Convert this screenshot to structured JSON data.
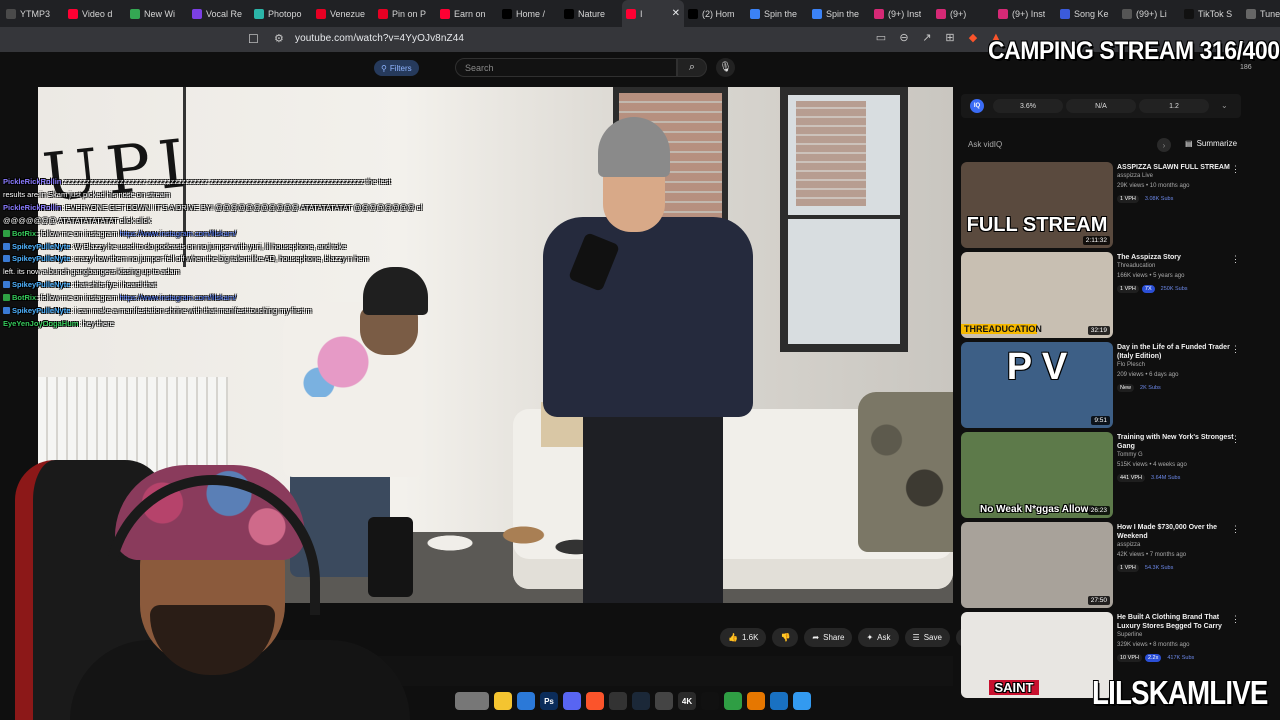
{
  "browser": {
    "tabs": [
      {
        "label": "YTMP3",
        "color": "#4a4a4a"
      },
      {
        "label": "Video d",
        "color": "#ff0033"
      },
      {
        "label": "New Wi",
        "color": "#34a853"
      },
      {
        "label": "Vocal Re",
        "color": "#7b3fe4"
      },
      {
        "label": "Photopo",
        "color": "#2bb5a8"
      },
      {
        "label": "Venezue",
        "color": "#e60023"
      },
      {
        "label": "Pin on P",
        "color": "#e60023"
      },
      {
        "label": "Earn on",
        "color": "#ff0033"
      },
      {
        "label": "Home /",
        "color": "#000000"
      },
      {
        "label": "Nature",
        "color": "#000000"
      },
      {
        "label": "I",
        "color": "#ff0033",
        "active": true,
        "close": "✕"
      },
      {
        "label": "(2) Hom",
        "color": "#000000"
      },
      {
        "label": "Spin the",
        "color": "#3b82f6"
      },
      {
        "label": "Spin the",
        "color": "#3b82f6"
      },
      {
        "label": "(9+) Inst",
        "color": "#d62976"
      },
      {
        "label": "(9+)",
        "color": "#d62976"
      },
      {
        "label": "(9+) Inst",
        "color": "#d62976"
      },
      {
        "label": "Song Ke",
        "color": "#3b5bdb"
      },
      {
        "label": "(99+) Li",
        "color": "#555555"
      },
      {
        "label": "TikTok S",
        "color": "#111111"
      },
      {
        "label": "Tunes",
        "color": "#666666"
      }
    ],
    "url": "youtube.com/watch?v=4YyOJv8nZ44",
    "bookmark_icon": "bookmark-icon",
    "addr_icons": [
      "screencast-icon",
      "zoom-icon",
      "share-icon",
      "install-icon",
      "brave-shields-icon",
      "rewards-icon"
    ]
  },
  "overlay": {
    "camping": "CAMPING STREAM 316/400",
    "channel": "LILSKAMLIVE",
    "counter": "186"
  },
  "youtube": {
    "filters_label": "Filters",
    "search_placeholder": "Search",
    "actions": {
      "like_count": "1.6K",
      "share": "Share",
      "ask": "Ask",
      "save": "Save"
    }
  },
  "chat": [
    {
      "user": "PickleRickRollin",
      "user_color": "#8a7bff",
      "text": " zzzzzzzzzzzzzzzzzzzzzz zzzzzzzzzzzzzzzz zzzzzzzzzzzzzzzzzzzzzzzzzzzzzzzzzzzzzzzzz the test",
      "badge": ""
    },
    {
      "user": "",
      "user_color": "#ffffff",
      "text": "results are in Skam just picked his nose on stream",
      "badge": ""
    },
    {
      "user": "PickleRickRollin",
      "user_color": "#8a7bff",
      "text": ": EVERYONE GET DOWN! IT'S A DRIVE BY! @@@@@@@@@@@ ATATATATATAT @@@@@@@@ click click",
      "badge": ""
    },
    {
      "user": "",
      "user_color": "#ffffff",
      "text": "@@@@@@@ ATATATATATATAT click click",
      "badge": ""
    },
    {
      "user": "BotRix",
      "user_color": "#35c95a",
      "text": ": follow me on instagram ",
      "link": "https://www.instagram.com/lilskam/",
      "badge": "#2ea043"
    },
    {
      "user": "SpikeyPulleNyte",
      "user_color": "#4fb3ff",
      "text": ": W Blazzy he used to do podcasts on no jumper with yuri, lil housephone, and toke",
      "badge": "#3a7bd5"
    },
    {
      "user": "SpikeyPulleNyte",
      "user_color": "#4fb3ff",
      "text": ": crazy how them no jumper fell off when the big talent like AD, housephone, blazzy n hem",
      "badge": "#3a7bd5"
    },
    {
      "user": "",
      "user_color": "#ffffff",
      "text": "left. its now a bunch gangbangers kissing up to adam",
      "badge": ""
    },
    {
      "user": "SpikeyPulleNyte",
      "user_color": "#4fb3ff",
      "text": ": that shits fye i heard that",
      "badge": "#3a7bd5"
    },
    {
      "user": "BotRix",
      "user_color": "#35c95a",
      "text": ": follow me on instagram ",
      "link": "https://www.instagram.com/lilskam/",
      "badge": "#2ea043"
    },
    {
      "user": "SpikeyPulleNyte",
      "user_color": "#4fb3ff",
      "text": ": i can make a manifestation shrine with that manifest touching my first m",
      "badge": "#3a7bd5"
    },
    {
      "user": "EyeYenJoyOogaHum",
      "user_color": "#35c95a",
      "text": ": hey there",
      "badge": ""
    }
  ],
  "sidebar": {
    "vidiq": {
      "logo": "IQ",
      "stats": [
        "3.6%",
        "N/A",
        "1.2"
      ]
    },
    "ask_placeholder": "Ask vidIQ",
    "summarize": "Summarize",
    "recommendations": [
      {
        "title": "ASSPIZZA SLAWN FULL STREAM",
        "channel": "asspizza Live",
        "meta": "29K views • 10 months ago",
        "badges": [
          "1 VPH",
          "",
          "3.08K Subs"
        ],
        "duration": "2:11:32",
        "thumb_text": "FULL STREAM",
        "thumb_bg": "#5a4a3e"
      },
      {
        "title": "The Asspizza Story",
        "channel": "Threaducation",
        "meta": "166K views • 5 years ago",
        "badges": [
          "1 VPH",
          "7X",
          "250K Subs"
        ],
        "duration": "32:19",
        "thumb_text": "THREADUCATION",
        "thumb_bg": "#c8bfb2"
      },
      {
        "title": "Day in the Life of a Funded Trader (Italy Edition)",
        "channel": "Flo Plesch",
        "meta": "209 views • 6 days ago",
        "badges": [
          "New",
          "",
          "2K Subs"
        ],
        "duration": "9:51",
        "thumb_text": "P  V",
        "thumb_bg": "#3d5f86"
      },
      {
        "title": "Training with New York's Strongest Gang",
        "channel": "Tommy G",
        "meta": "515K views • 4 weeks ago",
        "badges": [
          "441 VPH",
          "",
          "3.64M Subs"
        ],
        "duration": "26:23",
        "thumb_text": "No Weak N*ggas Allowe",
        "thumb_bg": "#5d7a4a"
      },
      {
        "title": "How I Made $730,000 Over the Weekend",
        "channel": "asspizza",
        "meta": "42K views • 7 months ago",
        "badges": [
          "1 VPH",
          "",
          "54.3K Subs"
        ],
        "duration": "27:50",
        "thumb_text": "",
        "thumb_bg": "#a8a29a"
      },
      {
        "title": "He Built A Clothing Brand That Luxury Stores Begged To Carry",
        "channel": "Superline",
        "meta": "329K views • 8 months ago",
        "badges": [
          "10 VPH",
          "2.2x",
          "417K Subs"
        ],
        "duration": "",
        "thumb_text": "SAINT",
        "thumb_bg": "#e8e6e2"
      }
    ]
  },
  "taskbar": [
    {
      "icon": "file-explorer-icon",
      "label": "",
      "color": "#f4c430"
    },
    {
      "icon": "store-icon",
      "label": "",
      "color": "#2b79d8"
    },
    {
      "icon": "photoshop-icon",
      "label": "Ps",
      "color": "#0b2c5a"
    },
    {
      "icon": "discord-icon",
      "label": "",
      "color": "#5865f2"
    },
    {
      "icon": "brave-icon",
      "label": "",
      "color": "#fb542b"
    },
    {
      "icon": "obs-icon",
      "label": "",
      "color": "#333333"
    },
    {
      "icon": "steam-icon",
      "label": "",
      "color": "#1b2838"
    },
    {
      "icon": "app-icon",
      "label": "",
      "color": "#444444"
    },
    {
      "icon": "4k-icon",
      "label": "4K",
      "color": "#2a2a2a"
    },
    {
      "icon": "capcut-icon",
      "label": "",
      "color": "#111111"
    },
    {
      "icon": "app-green-icon",
      "label": "",
      "color": "#2f9e44"
    },
    {
      "icon": "app-orange-icon",
      "label": "",
      "color": "#e67700"
    },
    {
      "icon": "app-blue-icon",
      "label": "",
      "color": "#1971c2"
    },
    {
      "icon": "notepad-icon",
      "label": "",
      "color": "#339af0"
    }
  ]
}
